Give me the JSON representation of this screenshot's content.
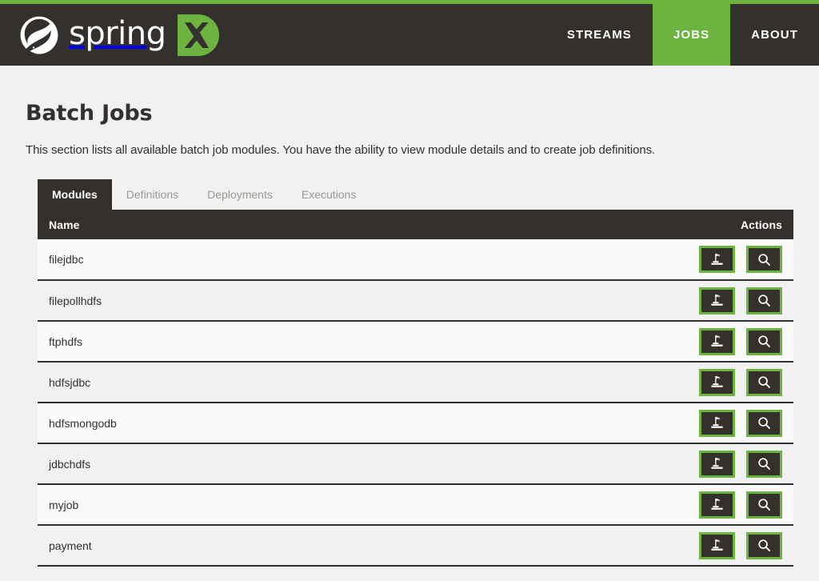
{
  "header": {
    "brand_name": "spring",
    "brand_badge": "X",
    "leaf_icon": "spring-leaf-icon",
    "nav": [
      {
        "label": "STREAMS",
        "active": false
      },
      {
        "label": "JOBS",
        "active": true
      },
      {
        "label": "ABOUT",
        "active": false
      }
    ]
  },
  "page": {
    "title": "Batch Jobs",
    "description": "This section lists all available batch job modules. You have the ability to view module details and to create job definitions."
  },
  "tabs": [
    {
      "label": "Modules",
      "active": true
    },
    {
      "label": "Definitions",
      "active": false
    },
    {
      "label": "Deployments",
      "active": false
    },
    {
      "label": "Executions",
      "active": false
    }
  ],
  "table": {
    "columns": [
      "Name",
      "Actions"
    ],
    "rows": [
      {
        "name": "filejdbc"
      },
      {
        "name": "filepollhdfs"
      },
      {
        "name": "ftphdfs"
      },
      {
        "name": "hdfsjdbc"
      },
      {
        "name": "hdfsmongodb"
      },
      {
        "name": "jdbchdfs"
      },
      {
        "name": "myjob"
      },
      {
        "name": "payment"
      }
    ],
    "row_actions": [
      {
        "icon": "deploy-flag-icon",
        "title": "Create Job Definition"
      },
      {
        "icon": "search-icon",
        "title": "View Details"
      }
    ]
  },
  "colors": {
    "brand_green": "#6db33f",
    "dark": "#34302d",
    "page_bg": "#f1f1f1",
    "row_odd": "#fafafa",
    "row_even": "#f1f1f1",
    "muted_text": "#9c9894"
  }
}
